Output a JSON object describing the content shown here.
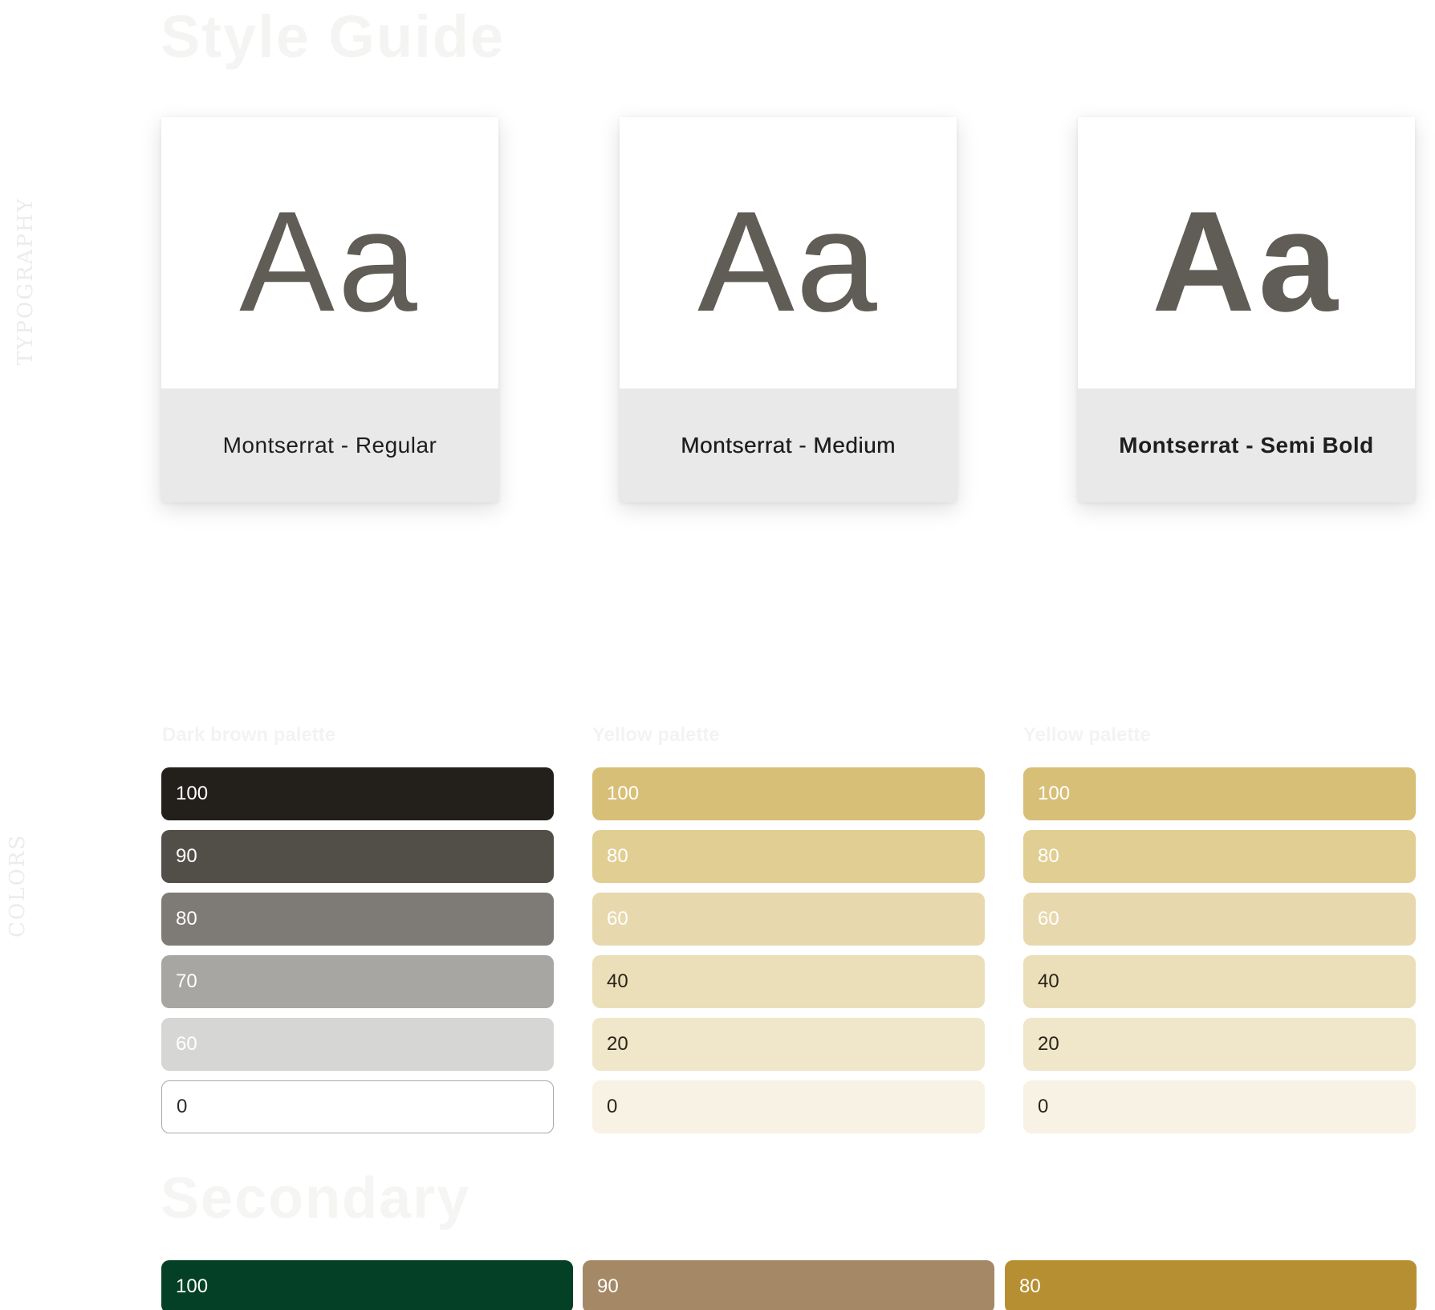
{
  "page": {
    "title": "Style Guide",
    "section_typography": "TYPOGRAPHY",
    "section_colors": "COLORS",
    "secondary_title": "Secondary"
  },
  "typography": {
    "sample_glyphs": "Aa",
    "cards": [
      {
        "label": "Montserrat - Regular",
        "weight": "regular"
      },
      {
        "label": "Montserrat - Medium",
        "weight": "medium"
      },
      {
        "label": "Montserrat - Semi Bold",
        "weight": "semibold"
      }
    ]
  },
  "palettes": [
    {
      "title": "Dark brown palette",
      "swatches": [
        {
          "label": "100",
          "color": "#23201c",
          "text_color": "#ffffff"
        },
        {
          "label": "90",
          "color": "#524f49",
          "text_color": "#ffffff"
        },
        {
          "label": "80",
          "color": "#7e7b76",
          "text_color": "#ffffff"
        },
        {
          "label": "70",
          "color": "#a7a6a3",
          "text_color": "#ffffff"
        },
        {
          "label": "60",
          "color": "#d6d6d5",
          "text_color": "#ffffff"
        },
        {
          "label": "0",
          "color": "#ffffff",
          "text_color": "#2a2a2a",
          "border": "#a8a8a8"
        }
      ]
    },
    {
      "title": "Yellow palette",
      "swatches": [
        {
          "label": "100",
          "color": "#d8bf77",
          "text_color": "#ffffff"
        },
        {
          "label": "80",
          "color": "#e1ce93",
          "text_color": "#ffffff"
        },
        {
          "label": "60",
          "color": "#e7d9ad",
          "text_color": "#ffffff"
        },
        {
          "label": "40",
          "color": "#ebdfb9",
          "text_color": "#2a2418"
        },
        {
          "label": "20",
          "color": "#f0e6c9",
          "text_color": "#2a2418"
        },
        {
          "label": "0",
          "color": "#f8f2e4",
          "text_color": "#2a2418"
        }
      ]
    },
    {
      "title": "Yellow palette",
      "swatches": [
        {
          "label": "100",
          "color": "#d8bf77",
          "text_color": "#ffffff"
        },
        {
          "label": "80",
          "color": "#e1ce93",
          "text_color": "#ffffff"
        },
        {
          "label": "60",
          "color": "#e7d9ad",
          "text_color": "#ffffff"
        },
        {
          "label": "40",
          "color": "#ebdfb9",
          "text_color": "#2a2418"
        },
        {
          "label": "20",
          "color": "#f0e6c9",
          "text_color": "#2a2418"
        },
        {
          "label": "0",
          "color": "#f8f2e4",
          "text_color": "#2a2418"
        }
      ]
    }
  ],
  "secondary": [
    {
      "label": "100",
      "color": "#044025",
      "text_color": "#ffffff"
    },
    {
      "label": "90",
      "color": "#a58866",
      "text_color": "#ffffff"
    },
    {
      "label": "80",
      "color": "#b78f33",
      "text_color": "#ffffff"
    }
  ]
}
